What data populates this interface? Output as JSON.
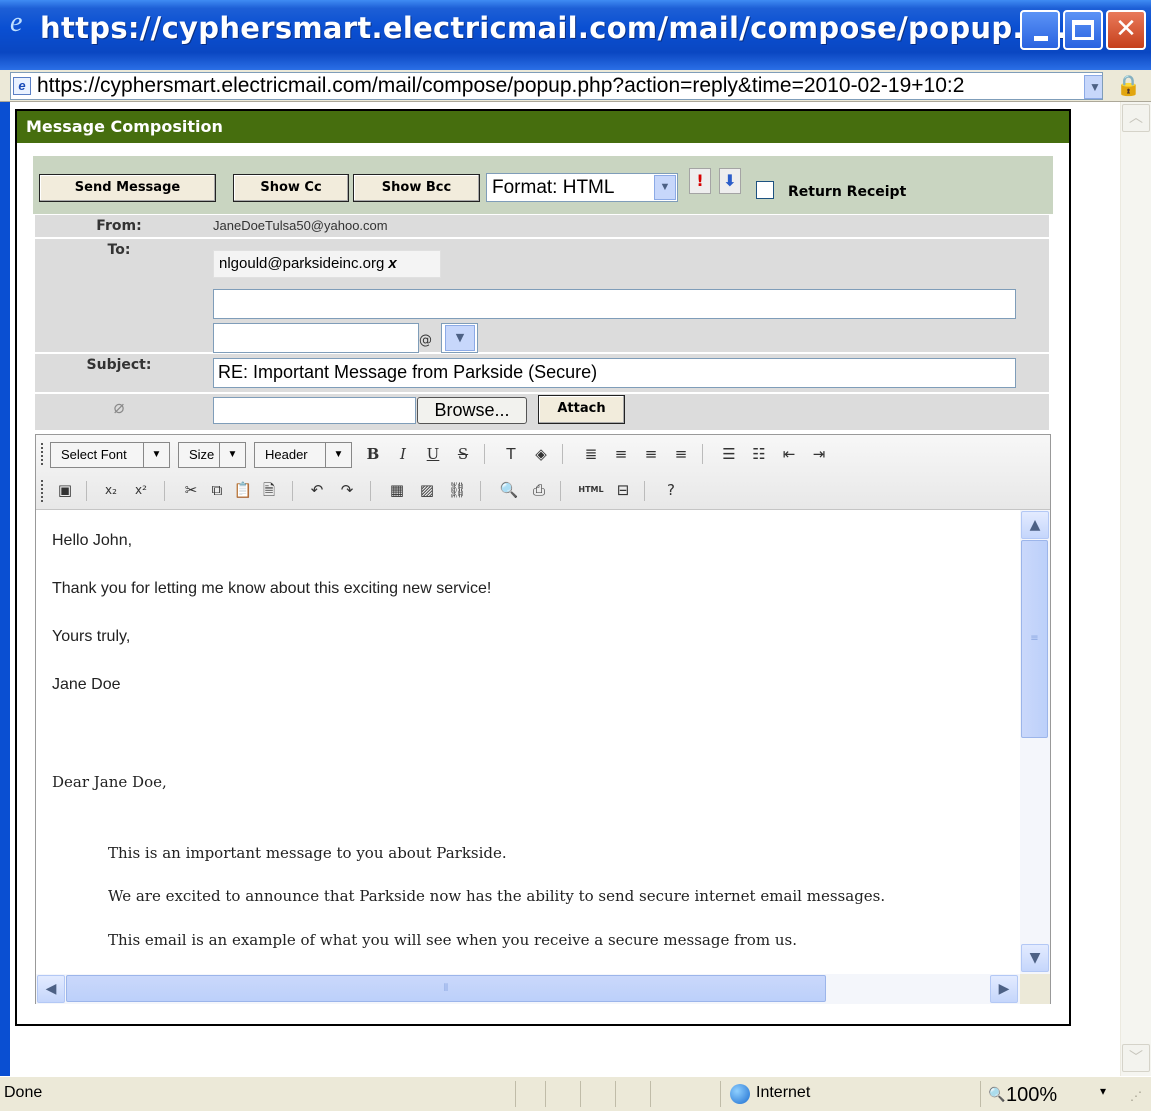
{
  "window": {
    "title": "https://cyphersmart.electricmail.com/mail/compose/popup.p...",
    "address": "https://cyphersmart.electricmail.com/mail/compose/popup.php?action=reply&time=2010-02-19+10:2"
  },
  "compose": {
    "header_title": "Message Composition",
    "buttons": {
      "send": "Send Message",
      "cc": "Show Cc",
      "bcc": "Show Bcc",
      "browse": "Browse...",
      "attach": "Attach"
    },
    "format_select": "Format: HTML",
    "return_receipt_label": "Return Receipt",
    "return_receipt_checked": false,
    "labels": {
      "from": "From:",
      "to": "To:",
      "subject": "Subject:"
    },
    "from_value": "JaneDoeTulsa50@yahoo.com",
    "to_recipient": "nlgould@parksideinc.org",
    "to_recipient_remove": "x",
    "to_input_value": "",
    "to_user_value": "",
    "at_sign": "@",
    "subject_value": "RE: Important Message from Parkside (Secure)",
    "attach_file_value": ""
  },
  "editor": {
    "toolbar": {
      "font_select": "Select Font",
      "size_select": "Size",
      "header_select": "Header"
    },
    "body": {
      "reply": [
        "Hello John,",
        "Thank you for letting me know about this exciting new service!",
        "Yours truly,",
        "Jane Doe"
      ],
      "quoted_greeting": "Dear Jane Doe,",
      "quoted": [
        "This is an important message to you about Parkside.",
        "We are excited to announce that Parkside now has the ability to send secure internet email messages.",
        "This email is an example of what you will see when you receive a secure message from us."
      ]
    }
  },
  "statusbar": {
    "status": "Done",
    "zone": "Internet",
    "zoom": "100%"
  },
  "colors": {
    "header_green": "#466e0e",
    "toolbar_bg": "#c9d5c1",
    "row_bg": "#dcdcdc",
    "titlebar_blue": "#0a4fd2"
  }
}
